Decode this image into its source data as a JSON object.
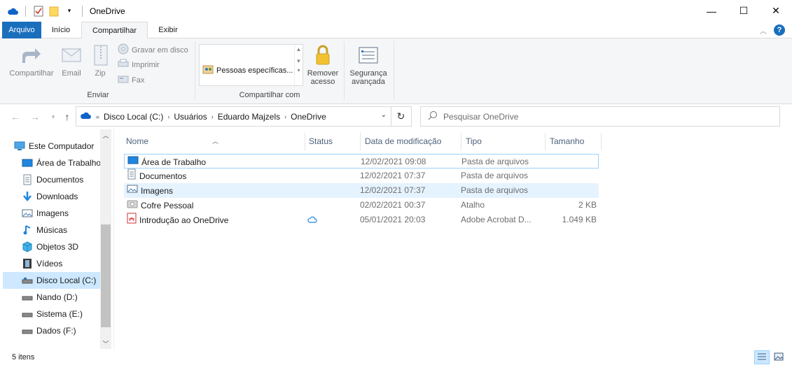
{
  "window": {
    "title": "OneDrive",
    "controls": {
      "minimize": "—",
      "maximize": "☐",
      "close": "✕"
    }
  },
  "ribbon_tabs": {
    "file": "Arquivo",
    "home": "Início",
    "share": "Compartilhar",
    "view": "Exibir"
  },
  "ribbon": {
    "share_button": "Compartilhar",
    "email_button": "Email",
    "zip_button": "Zip",
    "burn_button": "Gravar em disco",
    "print_button": "Imprimir",
    "fax_button": "Fax",
    "send_group": "Enviar",
    "gallery_item": "Pessoas específicas...",
    "remove_access_line1": "Remover",
    "remove_access_line2": "acesso",
    "advanced_security_line1": "Segurança",
    "advanced_security_line2": "avançada",
    "share_with_group": "Compartilhar com"
  },
  "address": {
    "overflow": "«",
    "crumbs": [
      "Disco Local (C:)",
      "Usuários",
      "Eduardo Majzels",
      "OneDrive"
    ]
  },
  "search": {
    "placeholder": "Pesquisar OneDrive"
  },
  "navigation_pane": {
    "items": [
      {
        "label": "Este Computador",
        "icon": "computer-icon"
      },
      {
        "label": "Área de Trabalho",
        "icon": "desktop-icon"
      },
      {
        "label": "Documentos",
        "icon": "documents-icon"
      },
      {
        "label": "Downloads",
        "icon": "downloads-icon"
      },
      {
        "label": "Imagens",
        "icon": "pictures-icon"
      },
      {
        "label": "Músicas",
        "icon": "music-icon"
      },
      {
        "label": "Objetos 3D",
        "icon": "objects-3d-icon"
      },
      {
        "label": "Vídeos",
        "icon": "videos-icon"
      },
      {
        "label": "Disco Local (C:)",
        "icon": "drive-icon",
        "selected": true
      },
      {
        "label": "Nando (D:)",
        "icon": "drive-icon"
      },
      {
        "label": "Sistema (E:)",
        "icon": "drive-icon"
      },
      {
        "label": "Dados (F:)",
        "icon": "drive-icon"
      }
    ]
  },
  "columns": {
    "name": "Nome",
    "status": "Status",
    "modified": "Data de modificação",
    "type": "Tipo",
    "size": "Tamanho"
  },
  "files": [
    {
      "name": "Área de Trabalho",
      "status": "",
      "modified": "12/02/2021 09:08",
      "type": "Pasta de arquivos",
      "size": "",
      "icon": "desktop-folder-icon"
    },
    {
      "name": "Documentos",
      "status": "",
      "modified": "12/02/2021 07:37",
      "type": "Pasta de arquivos",
      "size": "",
      "icon": "documents-folder-icon"
    },
    {
      "name": "Imagens",
      "status": "",
      "modified": "12/02/2021 07:37",
      "type": "Pasta de arquivos",
      "size": "",
      "icon": "pictures-folder-icon"
    },
    {
      "name": "Cofre Pessoal",
      "status": "",
      "modified": "02/02/2021 00:37",
      "type": "Atalho",
      "size": "2 KB",
      "icon": "vault-shortcut-icon"
    },
    {
      "name": "Introdução ao OneDrive",
      "status": "cloud",
      "modified": "05/01/2021 20:03",
      "type": "Adobe Acrobat D...",
      "size": "1.049 KB",
      "icon": "pdf-icon"
    }
  ],
  "status_bar": {
    "item_count": "5 itens"
  },
  "colors": {
    "accent": "#1a6fbd",
    "selection": "#cde8ff",
    "hover": "#e5f3ff",
    "focus_border": "#99d1ff",
    "onedrive_blue": "#0f64c8"
  }
}
